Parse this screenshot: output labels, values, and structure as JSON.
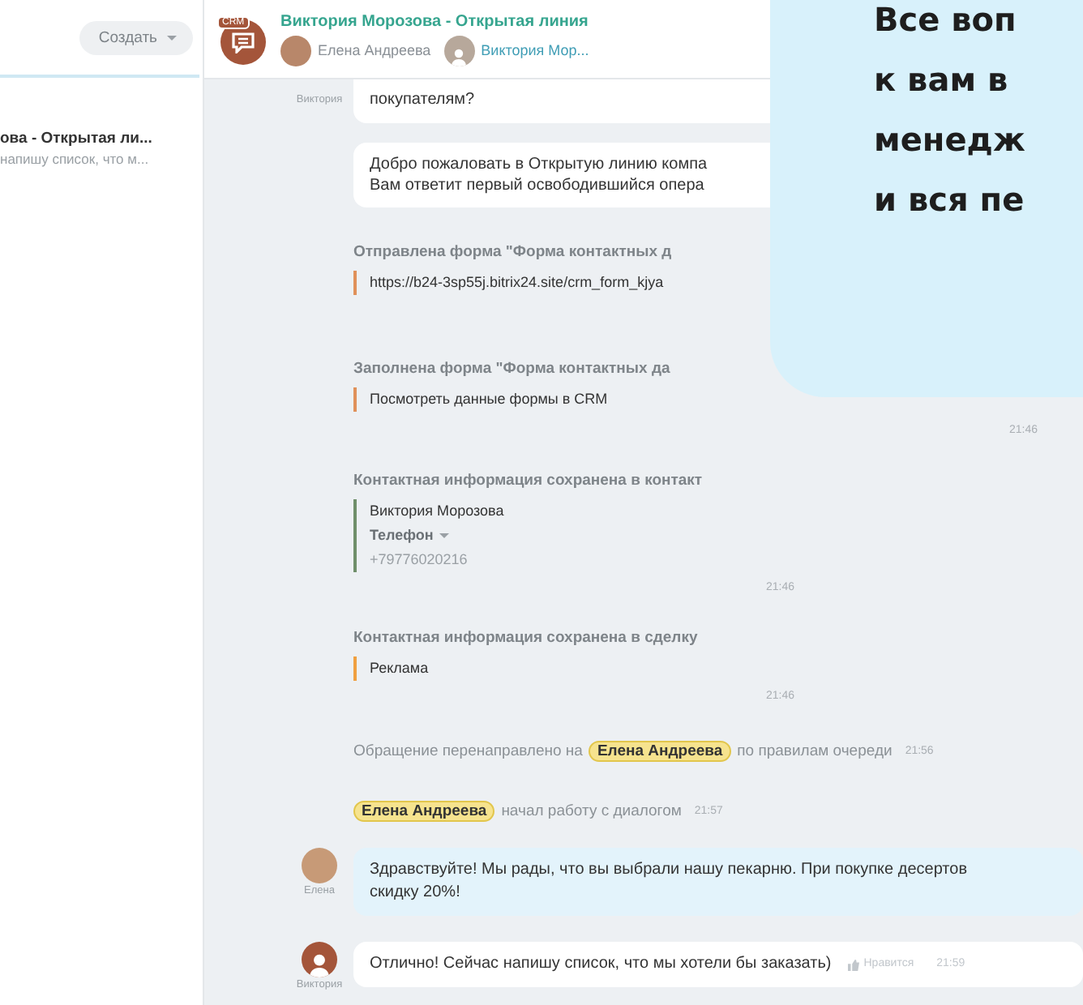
{
  "sidebar": {
    "create_button": "Создать",
    "chats": [
      {
        "title": "ова - Открытая ли...",
        "preview": "напишу список, что м..."
      }
    ]
  },
  "header": {
    "badge": "CRM",
    "title": "Виктория Морозова - Открытая линия",
    "participants": [
      {
        "name": "Елена Андреева",
        "avatar": {
          "kind": "photo"
        },
        "color": "#8a9096"
      },
      {
        "name": "Виктория Мор...",
        "avatar": {
          "kind": "silhouette"
        },
        "color": "#3f9db5"
      }
    ]
  },
  "messages": [
    {
      "kind": "message",
      "sender": "Виктория",
      "own": false,
      "lines": [
        "покупателям?"
      ]
    },
    {
      "kind": "system_bubble",
      "lines": [
        "Добро пожаловать в Открытую линию компа",
        "Вам ответит первый освободившийся опера"
      ]
    },
    {
      "kind": "block",
      "title": "Отправлена форма \"Форма контактных д",
      "color": "#e0915a",
      "lines": [
        {
          "kind": "plain",
          "text": "https://b24-3sp55j.bitrix24.site/crm_form_kjya"
        }
      ]
    },
    {
      "kind": "block",
      "title": "Заполнена форма \"Форма контактных да",
      "color": "#e0915a",
      "lines": [
        {
          "kind": "plain",
          "text": "Посмотреть данные формы в CRM"
        }
      ]
    },
    {
      "kind": "timestamp",
      "text": "21:46"
    },
    {
      "kind": "block",
      "title": "Контактная информация сохранена в контакт",
      "color": "#6f8f6a",
      "lines": [
        {
          "kind": "plain",
          "text": "Виктория Морозова"
        },
        {
          "kind": "dropdown",
          "text": "Телефон"
        },
        {
          "kind": "muted",
          "text": "+79776020216"
        }
      ],
      "time": "21:46"
    },
    {
      "kind": "block",
      "title": "Контактная информация сохранена в сделку",
      "color": "#f0a040",
      "lines": [
        {
          "kind": "plain",
          "text": "Реклама"
        }
      ],
      "time": "21:46"
    },
    {
      "kind": "event",
      "parts": [
        {
          "kind": "text",
          "text": "Обращение перенаправлено на"
        },
        {
          "kind": "mention",
          "text": "Елена Андреева"
        },
        {
          "kind": "text",
          "text": "по правилам очереди"
        }
      ],
      "time": "21:56"
    },
    {
      "kind": "event",
      "parts": [
        {
          "kind": "mention",
          "text": "Елена Андреева"
        },
        {
          "kind": "text",
          "text": "начал работу с диалогом"
        }
      ],
      "time": "21:57"
    },
    {
      "kind": "message",
      "sender": "Елена",
      "avatar": {
        "kind": "photo"
      },
      "own": true,
      "lines": [
        "Здравствуйте! Мы рады, что вы выбрали нашу пекарню. При покупке десертов",
        "скидку 20%!"
      ]
    },
    {
      "kind": "message",
      "sender": "Виктория",
      "avatar": {
        "kind": "silhouette"
      },
      "own": false,
      "lines": [
        "Отлично! Сейчас напишу список, что мы хотели бы заказать)"
      ],
      "like": "Нравится",
      "time": "21:59"
    }
  ],
  "callout": {
    "lines": [
      "Все воп",
      "к вам в",
      "менедж",
      "и вся пе"
    ]
  }
}
